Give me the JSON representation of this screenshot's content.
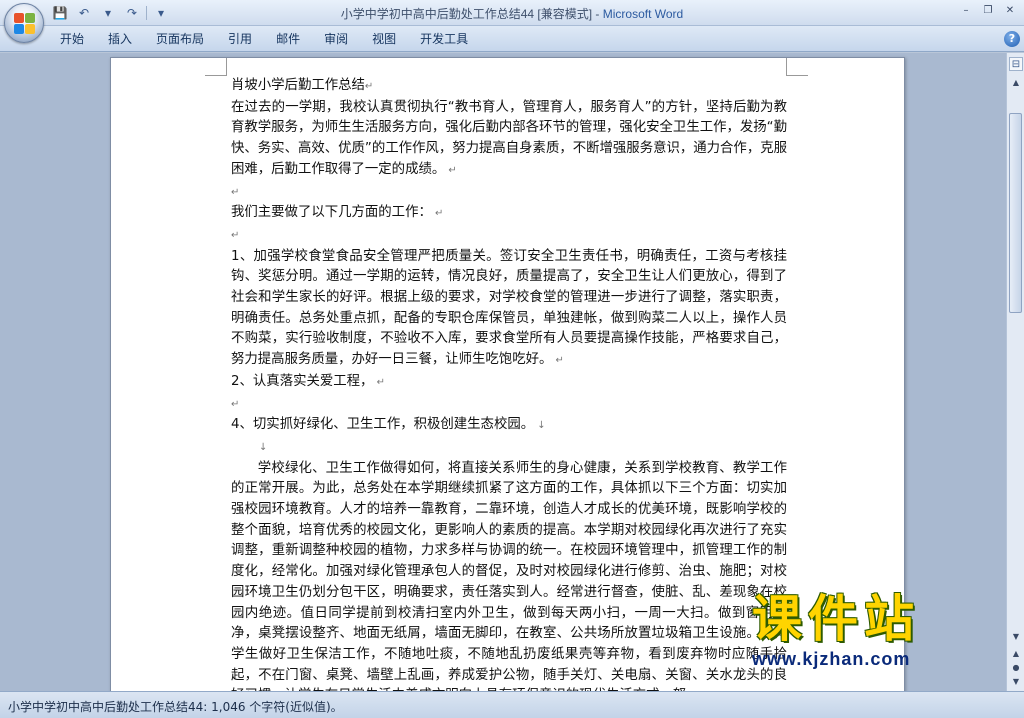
{
  "window": {
    "title_doc": "小学中学初中高中后勤处工作总结44 [兼容模式] - ",
    "title_app": "Microsoft Word",
    "controls": {
      "minimize": "–",
      "restore": "❐",
      "close": "✕"
    }
  },
  "quick_access": {
    "save": "💾",
    "undo": "↶",
    "dropdown1": "▾",
    "redo": "↷",
    "customize": "▾"
  },
  "ribbon": {
    "tabs": [
      "开始",
      "插入",
      "页面布局",
      "引用",
      "邮件",
      "审阅",
      "视图",
      "开发工具"
    ],
    "help": "?"
  },
  "document": {
    "title": "肖坡小学后勤工作总结",
    "para1": "在过去的一学期，我校认真贯彻执行“教书育人，管理育人，服务育人”的方针，坚持后勤为教育教学服务，为师生生活服务方向，强化后勤内部各环节的管理，强化安全卫生工作，发扬“勤快、务实、高效、优质”的工作作风，努力提高自身素质，不断增强服务意识，通力合作，克服困难，后勤工作取得了一定的成绩。",
    "intro": "我们主要做了以下几方面的工作：",
    "item1": "1、加强学校食堂食品安全管理严把质量关。签订安全卫生责任书，明确责任，工资与考核挂钩、奖惩分明。通过一学期的运转，情况良好，质量提高了，安全卫生让人们更放心，得到了社会和学生家长的好评。根据上级的要求，对学校食堂的管理进一步进行了调整，落实职责，明确责任。总务处重点抓，配备的专职仓库保管员，单独建帐，做到购菜二人以上，操作人员不购菜，实行验收制度，不验收不入库，要求食堂所有人员要提高操作技能，严格要求自己，努力提高服务质量，办好一日三餐，让师生吃饱吃好。",
    "item2": "2、认真落实关爱工程，",
    "item4": "4、切实抓好绿化、卫生工作，积极创建生态校园。",
    "para_green": "学校绿化、卫生工作做得如何，将直接关系师生的身心健康，关系到学校教育、教学工作的正常开展。为此，总务处在本学期继续抓紧了这方面的工作，具体抓以下三个方面：切实加强校园环境教育。人才的培养一靠教育，二靠环境，创造人才成长的优美环境，既影响学校的整个面貌，培育优秀的校园文化，更影响人的素质的提高。本学期对校园绿化再次进行了充实调整，重新调整种校园的植物，力求多样与协调的统一。在校园环境管理中，抓管理工作的制度化，经常化。加强对绿化管理承包人的督促，及时对校园绿化进行修剪、治虫、施肥；对校园环境卫生仍划分包干区，明确要求，责任落实到人。经常进行督查，使脏、乱、差现象在校园内绝迹。值日同学提前到校清扫室内外卫生，做到每天两小扫，一周一大扫。做到窗明几净，桌凳摆设整齐、地面无纸屑，墙面无脚印，在教室、公共场所放置垃圾箱卫生设施。全体学生做好卫生保洁工作，不随地吐痰，不随地乱扔废纸果壳等弃物，看到废弃物时应随手拾起，不在门窗、桌凳、墙壁上乱画，养成爱护公物，随手关灯、关电扇、关窗、关水龙头的良好习惯，让学生在日常生活中养成文明向上具有环保意识的现代生活方式。努"
  },
  "watermark": {
    "main": "课件站",
    "url": "www.kjzhan.com"
  },
  "status": {
    "text": "小学中学初中高中后勤处工作总结44: 1,046 个字符(近似值)。"
  },
  "colors": {
    "ribbon_bg": "#c6d6ec",
    "workspace_bg": "#a9b9d0",
    "app_title": "#2c5aa0",
    "watermark_yellow": "#ffd400"
  }
}
